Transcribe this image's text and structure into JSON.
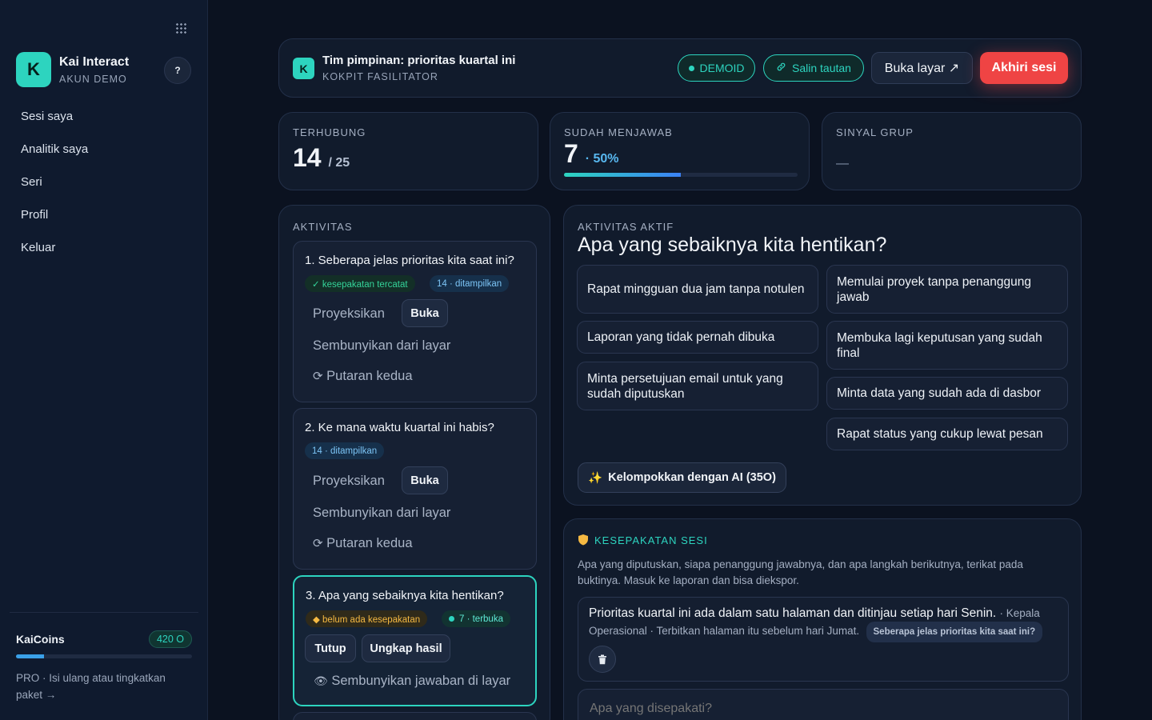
{
  "sidebar": {
    "brand_initial": "K",
    "brand_name": "Kai Interact",
    "brand_sub": "AKUN DEMO",
    "help_label": "?",
    "nav": [
      "Sesi saya",
      "Analitik saya",
      "Seri",
      "Profil",
      "Keluar"
    ],
    "coins": {
      "title": "KaiCoins",
      "badge": "420 O",
      "progress": 0.16,
      "link": "PRO · Isi ulang atau tingkatkan paket →"
    }
  },
  "header": {
    "initial": "K",
    "title": "Tim pimpinan: prioritas kuartal ini",
    "subtitle": "KOKPIT FASILITATOR",
    "demo_label": "DEMOID",
    "copy_label": "Salin tautan",
    "open_label": "Buka layar ↗",
    "end_label": "Akhiri sesi"
  },
  "stats": {
    "connected": {
      "label": "TERHUBUNG",
      "value": "14",
      "total": "/ 25"
    },
    "answered": {
      "label": "SUDAH MENJAWAB",
      "value": "7",
      "pct": "· 50%",
      "progress": 0.5
    },
    "signal": {
      "label": "SINYAL GRUP",
      "value": "—"
    }
  },
  "activities": {
    "label": "AKTIVITAS",
    "items": [
      {
        "question": "1. Seberapa jelas prioritas kita saat ini?",
        "tag1": "✓ kesepakatan tercatat",
        "tag2": "14 · ditampilkan",
        "project": "Proyeksikan",
        "open": "Buka",
        "hide": "Sembunyikan dari layar",
        "round": "Putaran kedua"
      },
      {
        "question": "2. Ke mana waktu kuartal ini habis?",
        "tag1": "14 · ditampilkan",
        "project": "Proyeksikan",
        "open": "Buka",
        "hide": "Sembunyikan dari layar",
        "round": "Putaran kedua"
      },
      {
        "question": "3. Apa yang sebaiknya kita hentikan?",
        "tag1": "◆ belum ada kesepakatan",
        "tag2": "7 · terbuka",
        "close": "Tutup",
        "reveal": "Ungkap hasil",
        "hide_answers": "Sembunyikan jawaban di layar"
      }
    ]
  },
  "live": {
    "label": "AKTIVITAS AKTIF",
    "title": "Apa yang sebaiknya kita hentikan?",
    "responses_left": [
      "Rapat mingguan dua jam tanpa notulen",
      "Laporan yang tidak pernah dibuka",
      "Minta persetujuan email untuk yang sudah diputuskan"
    ],
    "responses_right": [
      "Memulai proyek tanpa penanggung jawab",
      "Membuka lagi keputusan yang sudah final",
      "Minta data yang sudah ada di dasbor",
      "Rapat status yang cukup lewat pesan"
    ],
    "ai_label": "Kelompokkan dengan AI (35O)"
  },
  "agreements": {
    "label": "KESEPAKATAN SESI",
    "desc": "Apa yang diputuskan, siapa penanggung jawabnya, dan apa langkah berikutnya, terikat pada buktinya. Masuk ke laporan dan bisa diekspor.",
    "item_text": "Prioritas kuartal ini ada dalam satu halaman dan ditinjau setiap hari Senin.",
    "item_meta": "· Kepala Operasional · Terbitkan halaman itu sebelum hari Jumat.",
    "item_ref": "Seberapa jelas prioritas kita saat ini?",
    "input_placeholder": "Apa yang disepakati?"
  }
}
